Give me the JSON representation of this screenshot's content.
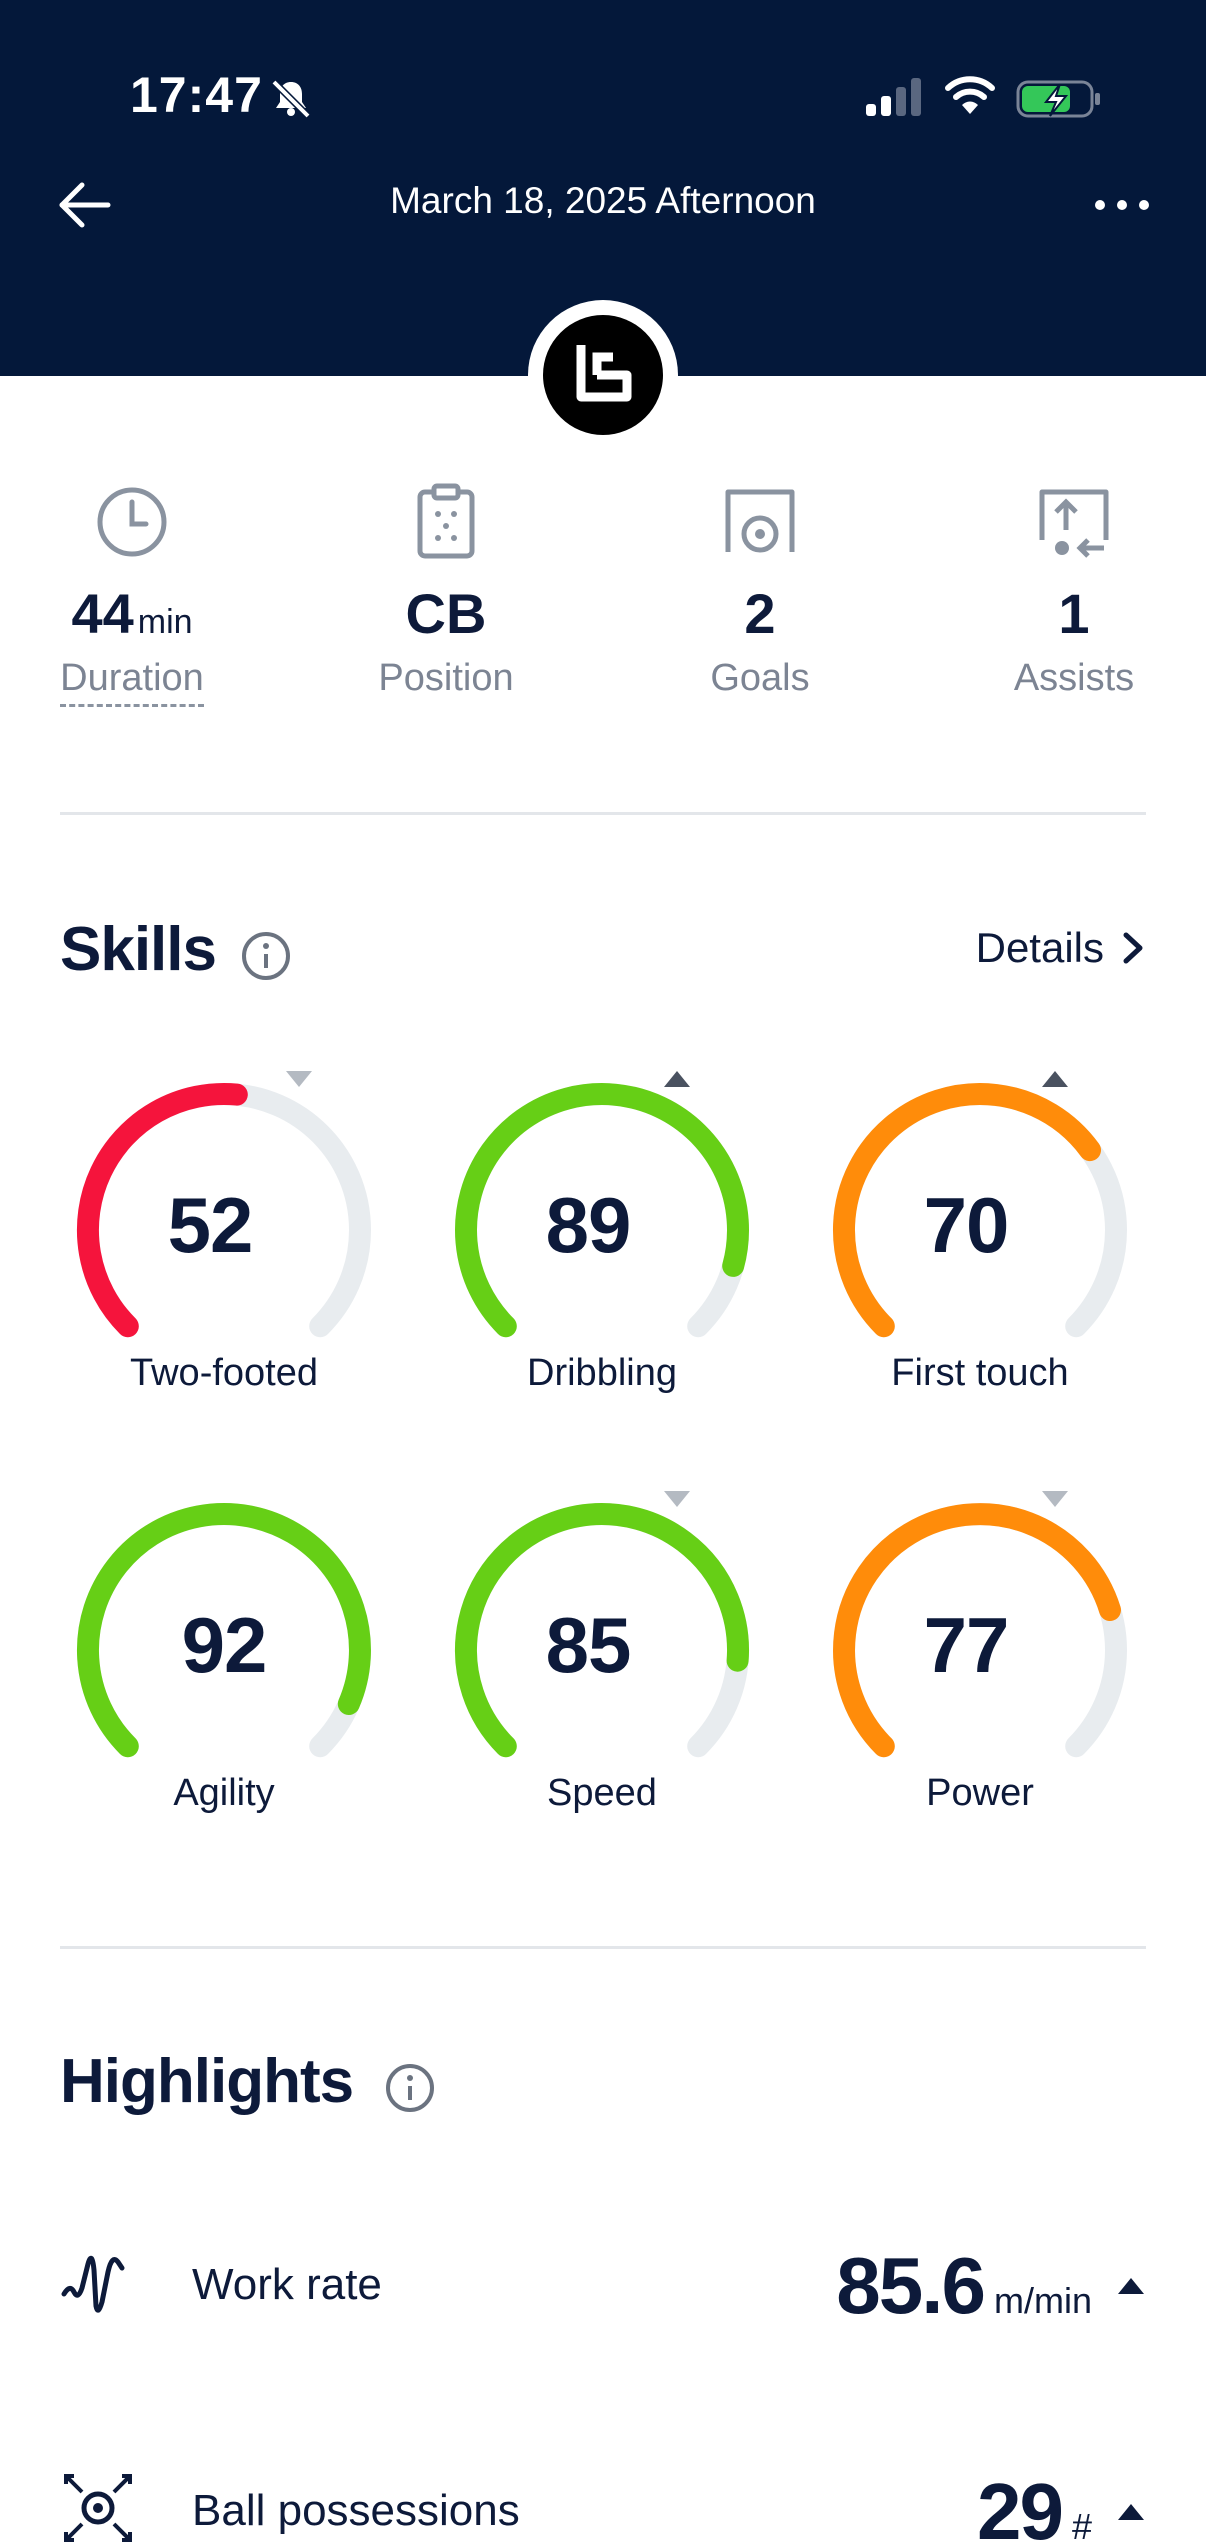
{
  "status_bar": {
    "time": "17:47"
  },
  "header": {
    "title": "March 18, 2025 Afternoon"
  },
  "stats": [
    {
      "value": "44",
      "unit": "min",
      "label": "Duration",
      "icon": "clock-icon"
    },
    {
      "value": "CB",
      "unit": "",
      "label": "Position",
      "icon": "clipboard-icon"
    },
    {
      "value": "2",
      "unit": "",
      "label": "Goals",
      "icon": "goal-icon"
    },
    {
      "value": "1",
      "unit": "",
      "label": "Assists",
      "icon": "assist-icon"
    }
  ],
  "skills": {
    "title": "Skills",
    "details_label": "Details",
    "items": [
      {
        "label": "Two-footed",
        "value": 52,
        "trend": "down",
        "color": "#f5143c"
      },
      {
        "label": "Dribbling",
        "value": 89,
        "trend": "up",
        "color": "#66cf16"
      },
      {
        "label": "First touch",
        "value": 70,
        "trend": "up",
        "color": "#ff8c0a"
      },
      {
        "label": "Agility",
        "value": 92,
        "trend": "none",
        "color": "#66cf16"
      },
      {
        "label": "Speed",
        "value": 85,
        "trend": "down",
        "color": "#66cf16"
      },
      {
        "label": "Power",
        "value": 77,
        "trend": "down",
        "color": "#ff8c0a"
      }
    ]
  },
  "highlights": {
    "title": "Highlights",
    "items": [
      {
        "label": "Work rate",
        "value": "85.6",
        "unit": "m/min",
        "trend": "up",
        "icon": "work-rate-icon"
      },
      {
        "label": "Ball possessions",
        "value": "29",
        "unit": "#",
        "trend": "up",
        "icon": "ball-possession-icon"
      }
    ]
  },
  "colors": {
    "header_bg": "#04183a",
    "text": "#0d1a3a",
    "track": "#e8ecef"
  }
}
